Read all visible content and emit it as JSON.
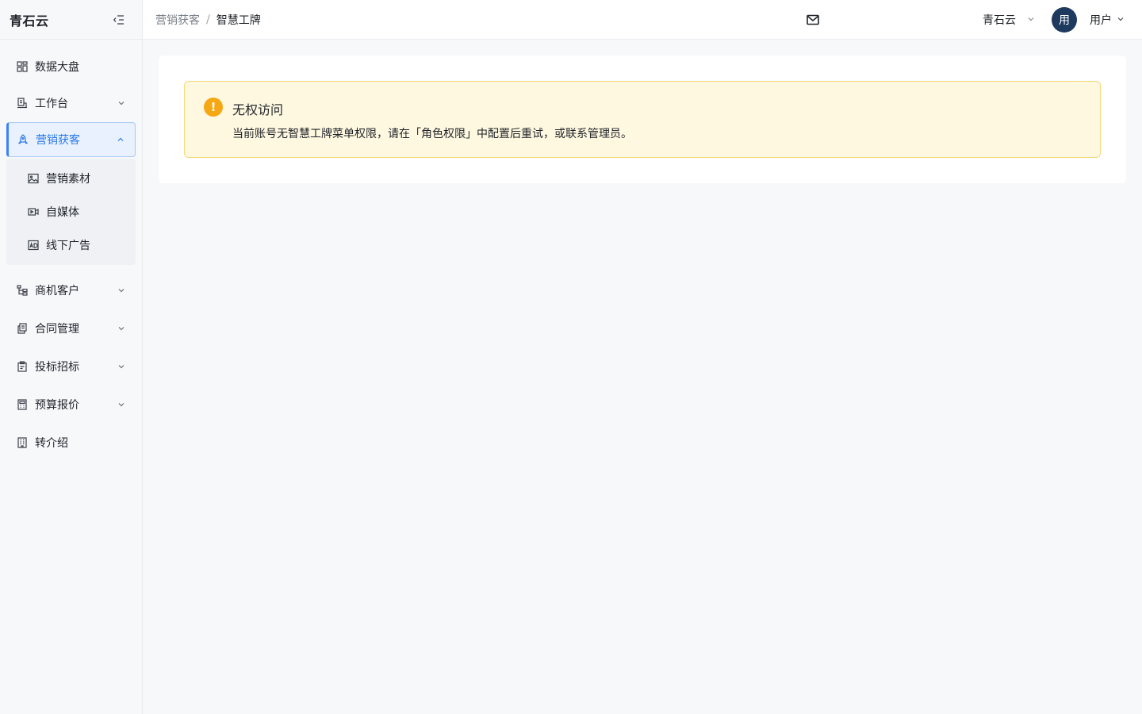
{
  "brand": {
    "title": "青石云"
  },
  "sidebar": {
    "items": [
      {
        "label": "数据大盘",
        "icon": "dashboard-icon"
      },
      {
        "label": "工作台",
        "icon": "workbench-icon"
      },
      {
        "label": "营销获客",
        "icon": "rocket-icon"
      },
      {
        "label": "商机客户",
        "icon": "hierarchy-icon"
      },
      {
        "label": "合同管理",
        "icon": "contract-icon"
      },
      {
        "label": "投标招标",
        "icon": "clipboard-icon"
      },
      {
        "label": "预算报价",
        "icon": "calculator-icon"
      },
      {
        "label": "转介绍",
        "icon": "building-icon"
      }
    ],
    "submenu": [
      {
        "label": "营销素材",
        "icon": "image-icon"
      },
      {
        "label": "自媒体",
        "icon": "video-icon"
      },
      {
        "label": "线下广告",
        "icon": "ad-icon"
      }
    ]
  },
  "header": {
    "breadcrumb": {
      "parent": "营销获客",
      "separator": "/",
      "current": "智慧工牌"
    },
    "org": "青石云",
    "avatar": "用",
    "user": "用户"
  },
  "alert": {
    "title": "无权访问",
    "description": "当前账号无智慧工牌菜单权限，请在「角色权限」中配置后重试，或联系管理员。",
    "icon": "!"
  },
  "colors": {
    "accent": "#2b79e6",
    "warning": "#f5a714",
    "alert_bg": "#fff8e0",
    "avatar_bg": "#1e3a5f"
  }
}
